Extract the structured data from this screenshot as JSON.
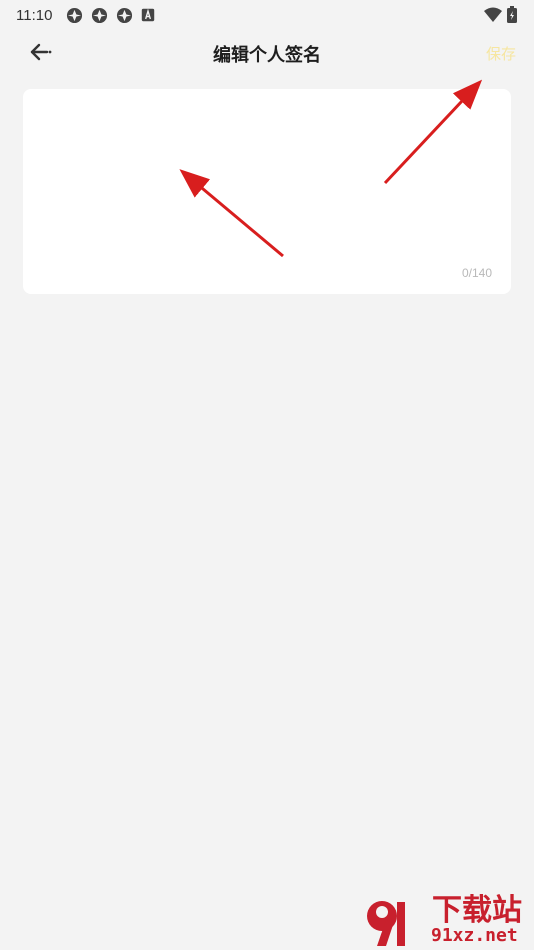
{
  "status_bar": {
    "time": "11:10",
    "icons": [
      "app-icon",
      "app-icon",
      "app-icon",
      "a-notification-icon"
    ],
    "right_icons": [
      "wifi-icon",
      "battery-charging-icon"
    ]
  },
  "nav": {
    "back_icon": "back-arrow-icon",
    "title": "编辑个人签名",
    "save_label": "保存",
    "save_color": "#f6e6a0"
  },
  "signature": {
    "value": "",
    "counter": "0/140"
  },
  "annotations": {
    "arrow_color": "#d81e1e"
  },
  "watermark": {
    "brand": "下载站",
    "site": "91xz.net",
    "brand_color": "#c8202d"
  }
}
